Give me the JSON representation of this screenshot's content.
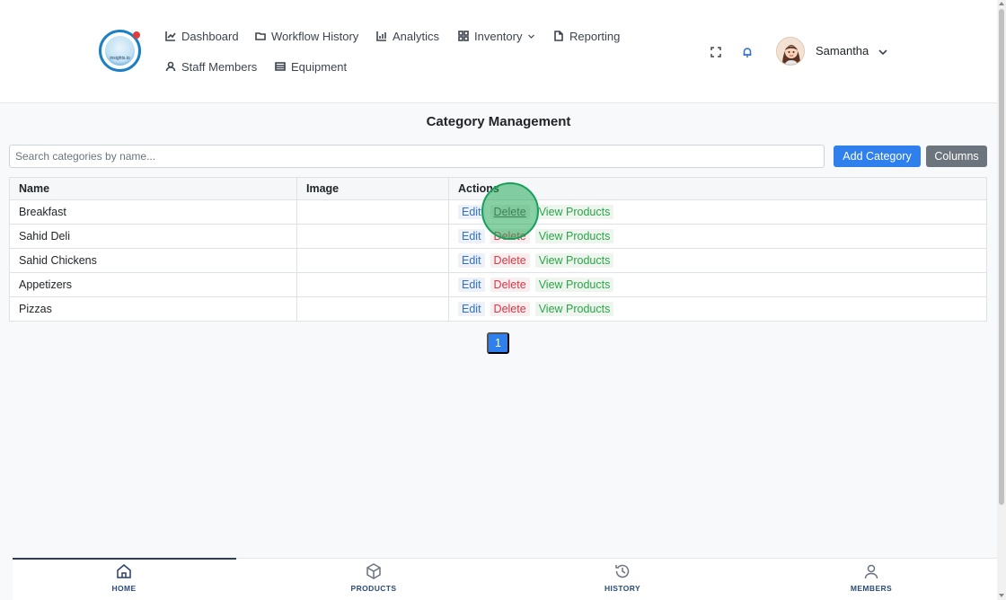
{
  "header": {
    "logo_text": "insights.io",
    "nav": [
      {
        "label": "Dashboard",
        "icon": "chart-line-icon"
      },
      {
        "label": "Workflow History",
        "icon": "folder-icon"
      },
      {
        "label": "Analytics",
        "icon": "bar-chart-icon"
      },
      {
        "label": "Inventory",
        "icon": "grid-icon"
      },
      {
        "label": "Reporting",
        "icon": "document-icon"
      },
      {
        "label": "Staff Members",
        "icon": "user-icon"
      },
      {
        "label": "Equipment",
        "icon": "list-icon"
      }
    ],
    "user_name": "Samantha"
  },
  "main": {
    "title": "Category Management",
    "search_placeholder": "Search categories by name...",
    "add_button": "Add Category",
    "columns_button": "Columns",
    "table": {
      "headers": [
        "Name",
        "Image",
        "Actions"
      ],
      "actions": {
        "edit": "Edit",
        "delete": "Delete",
        "view": "View Products"
      },
      "rows": [
        {
          "name": "Breakfast"
        },
        {
          "name": "Sahid Deli"
        },
        {
          "name": "Sahid Chickens"
        },
        {
          "name": "Appetizers"
        },
        {
          "name": "Pizzas"
        }
      ]
    },
    "page": "1"
  },
  "bottom_nav": [
    {
      "label": "HOME",
      "icon": "home-icon",
      "active": true
    },
    {
      "label": "PRODUCTS",
      "icon": "box-icon",
      "active": false
    },
    {
      "label": "HISTORY",
      "icon": "history-icon",
      "active": false
    },
    {
      "label": "MEMBERS",
      "icon": "user-icon",
      "active": false
    }
  ],
  "colors": {
    "primary": "#2f80ed",
    "secondary": "#6c757d",
    "danger": "#dc3545",
    "success": "#28a745",
    "nav_active": "#2b3e63"
  }
}
